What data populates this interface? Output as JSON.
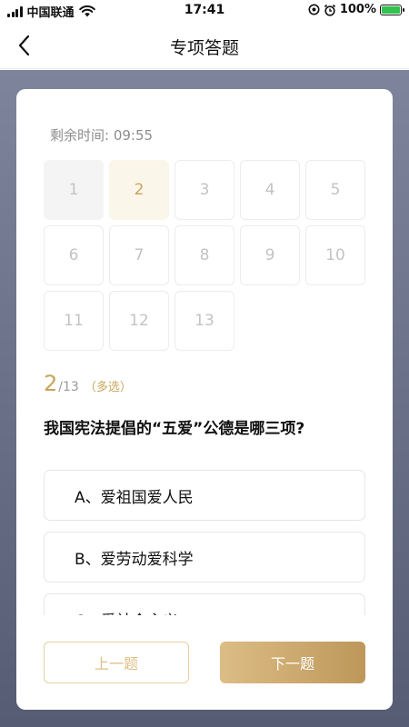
{
  "status_bar": {
    "carrier": "中国联通",
    "time": "17:41",
    "battery_percent": "100%",
    "battery_level": 1.0,
    "icons": [
      "signal-icon",
      "wifi-icon",
      "location-lock-icon",
      "alarm-icon",
      "battery-charging-icon"
    ]
  },
  "nav": {
    "title": "专项答题",
    "back_icon": "chevron-left-icon"
  },
  "quiz": {
    "timer_label": "剩余时间: 09:55",
    "question_cells": [
      {
        "label": "1",
        "state": "visited"
      },
      {
        "label": "2",
        "state": "current"
      },
      {
        "label": "3",
        "state": "default"
      },
      {
        "label": "4",
        "state": "default"
      },
      {
        "label": "5",
        "state": "default"
      },
      {
        "label": "6",
        "state": "default"
      },
      {
        "label": "7",
        "state": "default"
      },
      {
        "label": "8",
        "state": "default"
      },
      {
        "label": "9",
        "state": "default"
      },
      {
        "label": "10",
        "state": "default"
      },
      {
        "label": "11",
        "state": "default"
      },
      {
        "label": "12",
        "state": "default"
      },
      {
        "label": "13",
        "state": "default"
      }
    ],
    "current_number": "2",
    "total_label": "/13",
    "type_label": "（多选）",
    "question_text": "我国宪法提倡的“五爱”公德是哪三项?",
    "options": [
      {
        "label": "A、爱祖国爱人民"
      },
      {
        "label": "B、爱劳动爱科学"
      },
      {
        "label": "C、爱社会主义"
      }
    ],
    "prev_label": "上一题",
    "next_label": "下一题"
  },
  "colors": {
    "accent": "#c9a55c",
    "backdrop_top": "#7d849c",
    "backdrop_bottom": "#555c74"
  }
}
